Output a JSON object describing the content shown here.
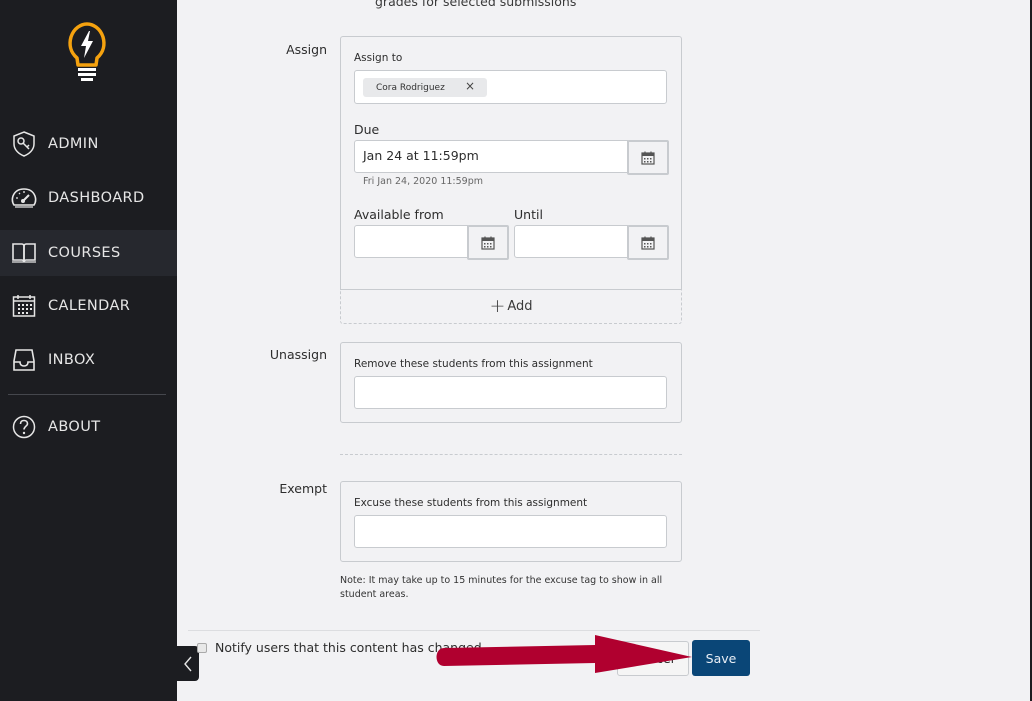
{
  "sidebar": {
    "logo": "lightbulb-logo",
    "items": [
      {
        "label": "ADMIN",
        "icon": "shield-key-icon",
        "active": false
      },
      {
        "label": "DASHBOARD",
        "icon": "speedometer-icon",
        "active": false
      },
      {
        "label": "COURSES",
        "icon": "book-icon",
        "active": true
      },
      {
        "label": "CALENDAR",
        "icon": "calendar-icon",
        "active": false
      },
      {
        "label": "INBOX",
        "icon": "inbox-icon",
        "active": false
      },
      {
        "label": "ABOUT",
        "icon": "question-icon",
        "active": false
      }
    ],
    "collapse_icon": "chevron-left-icon"
  },
  "main": {
    "top_text": "grades for selected submissions",
    "assign": {
      "row_label": "Assign",
      "assign_to_label": "Assign to",
      "assignees": [
        {
          "name": "Cora Rodriguez",
          "remove": "×"
        }
      ],
      "due_label": "Due",
      "due_value": "Jan 24 at 11:59pm",
      "due_hint": "Fri Jan 24, 2020 11:59pm",
      "available_from_label": "Available from",
      "available_from_value": "",
      "until_label": "Until",
      "until_value": "",
      "add_label": "Add",
      "add_icon": "+"
    },
    "unassign": {
      "row_label": "Unassign",
      "field_label": "Remove these students from this assignment",
      "value": ""
    },
    "exempt": {
      "row_label": "Exempt",
      "field_label": "Excuse these students from this assignment",
      "value": "",
      "note": "Note: It may take up to 15 minutes for the excuse tag to show in all student areas."
    }
  },
  "footer": {
    "notify_label": "Notify users that this content has changed",
    "notify_checked": false,
    "cancel_label": "Cancel",
    "save_label": "Save"
  },
  "annotation": {
    "type": "arrow",
    "points_to": "save-button",
    "color": "#b0002f"
  },
  "colors": {
    "sidebar_bg": "#1c1d21",
    "sidebar_active": "#26282e",
    "logo_accent": "#f5a20f",
    "save_button": "#0a4677",
    "page_bg": "#f2f2f4"
  }
}
